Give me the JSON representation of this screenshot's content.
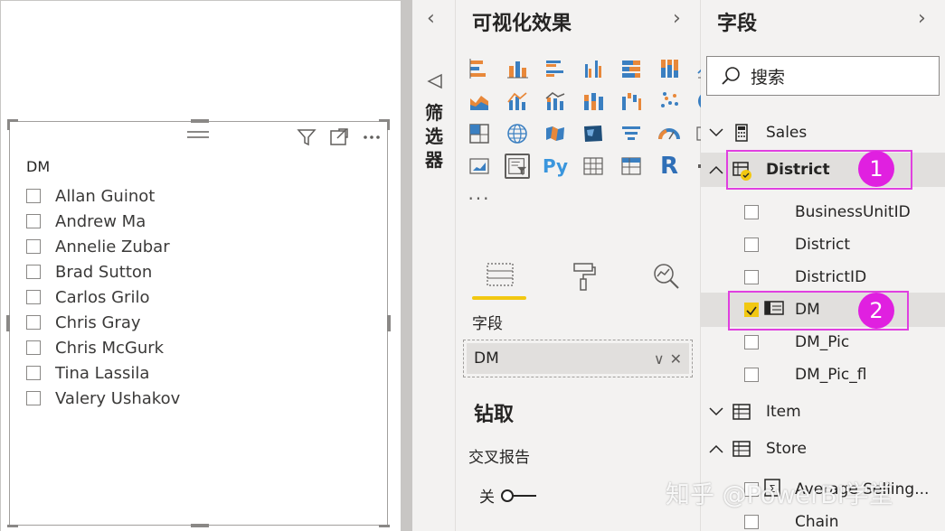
{
  "slicer": {
    "title": "DM",
    "items": [
      "Allan Guinot",
      "Andrew Ma",
      "Annelie Zubar",
      "Brad Sutton",
      "Carlos Grilo",
      "Chris Gray",
      "Chris McGurk",
      "Tina Lassila",
      "Valery Ushakov"
    ],
    "tools": [
      "filter-icon",
      "focus-mode-icon",
      "more-options-icon"
    ]
  },
  "filters": {
    "label": "筛选器",
    "collapse_glyph": "‹"
  },
  "viz": {
    "title": "可视化效果",
    "chevron": "›",
    "icons": [
      "stacked-bar-icon",
      "stacked-column-icon",
      "clustered-bar-icon",
      "clustered-column-icon",
      "100-stacked-bar-icon",
      "100-stacked-column-icon",
      "line-chart-icon",
      "area-chart-icon",
      "stacked-area-icon",
      "line-clustered-column-icon",
      "line-stacked-column-icon",
      "ribbon-chart-icon",
      "waterfall-icon",
      "scatter-icon",
      "pie-icon",
      "donut-icon",
      "treemap-icon",
      "map-icon",
      "filled-map-icon",
      "shape-map-icon",
      "funnel-icon",
      "gauge-icon",
      "card-icon",
      "multi-row-card-icon",
      "kpi-icon",
      "slicer-icon",
      "python-visual-icon",
      "table-icon",
      "matrix-icon",
      "r-visual-icon",
      "decomposition-tree-icon",
      "arcgis-map-icon",
      "more-visuals-icon"
    ],
    "py_label": "Py",
    "r_label": "R",
    "more_label": "···",
    "tabs": [
      "fields-tab-icon",
      "format-tab-icon",
      "analytics-tab-icon"
    ],
    "well_label": "字段",
    "well_value": "DM",
    "well_chevron": "∨",
    "well_remove": "✕",
    "drill_title": "钻取",
    "cross_report_label": "交叉报告",
    "toggle_label": "关"
  },
  "fields": {
    "title": "字段",
    "chevron": "›",
    "search_placeholder": "搜索",
    "tables": [
      {
        "name": "Sales",
        "expanded": false
      },
      {
        "name": "District",
        "expanded": true
      }
    ],
    "district_fields": [
      {
        "name": "BusinessUnitID",
        "checked": false
      },
      {
        "name": "District",
        "checked": false
      },
      {
        "name": "DistrictID",
        "checked": false
      },
      {
        "name": "DM",
        "checked": true
      },
      {
        "name": "DM_Pic",
        "checked": false
      },
      {
        "name": "DM_Pic_fl",
        "checked": false
      }
    ],
    "more_tables": [
      {
        "name": "Item",
        "expanded": false
      },
      {
        "name": "Store",
        "expanded": true
      }
    ],
    "store_fields": [
      {
        "name": "Average Selling...",
        "checked": false
      },
      {
        "name": "Chain",
        "checked": false
      }
    ],
    "callouts": [
      "1",
      "2"
    ]
  },
  "watermark": "知乎 @PowerBI学堂",
  "colors": {
    "accent": "#f2c811",
    "callout": "#e020e0",
    "pane_bg": "#f3f2f1"
  }
}
